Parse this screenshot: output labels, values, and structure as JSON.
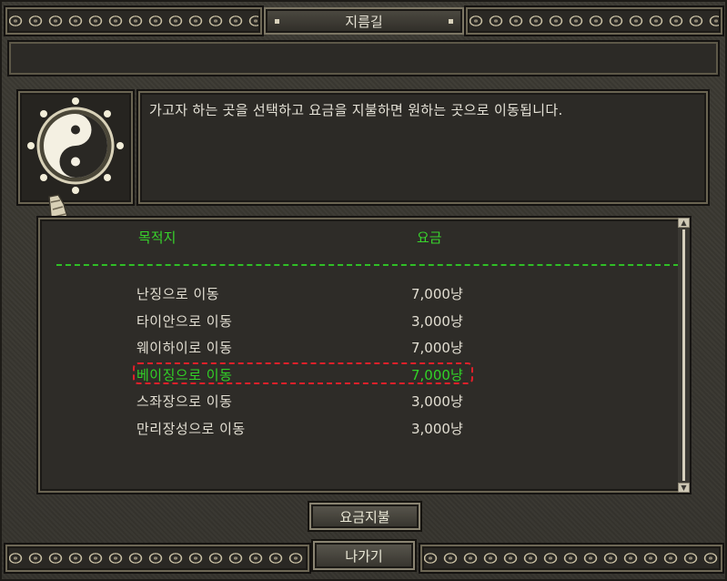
{
  "window": {
    "title": "지름길"
  },
  "description": "가고자 하는 곳을 선택하고 요금을 지불하면 원하는 곳으로 이동됩니다.",
  "portrait": {
    "icon": "yin-yang-icon",
    "cursor_icon": "gauntlet-cursor-icon"
  },
  "list": {
    "headers": {
      "destination": "목적지",
      "fee": "요금"
    },
    "rows": [
      {
        "destination": "난징으로 이동",
        "fee": "7,000냥",
        "selected": false
      },
      {
        "destination": "타이안으로 이동",
        "fee": "3,000냥",
        "selected": false
      },
      {
        "destination": "웨이하이로 이동",
        "fee": "7,000냥",
        "selected": false
      },
      {
        "destination": "베이징으로 이동",
        "fee": "7,000냥",
        "selected": true
      },
      {
        "destination": "스좌장으로 이동",
        "fee": "3,000냥",
        "selected": false
      },
      {
        "destination": "만리장성으로 이동",
        "fee": "3,000냥",
        "selected": false
      }
    ]
  },
  "buttons": {
    "pay": "요금지불",
    "exit": "나가기"
  },
  "colors": {
    "header_green": "#38d42c",
    "selected_green": "#31d227",
    "highlight_red": "#e0202a",
    "text": "#e2ded2"
  }
}
